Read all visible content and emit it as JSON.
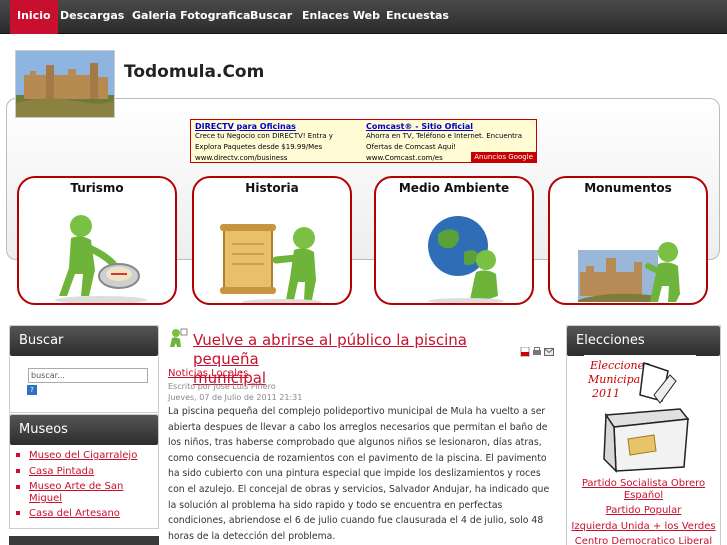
{
  "nav": {
    "items": [
      {
        "label": "Inicio",
        "active": true
      },
      {
        "label": "Descargas"
      },
      {
        "label": "Galeria Fotografica"
      },
      {
        "label": "Buscar"
      },
      {
        "label": "Enlaces Web"
      },
      {
        "label": "Encuestas"
      }
    ]
  },
  "site": {
    "title": "Todomula.Com"
  },
  "ad": {
    "left": {
      "head": "DIRECTV para Oficinas",
      "line1": "Crece tu Negocio con DIRECTV! Entra y",
      "line2": "Explora Paquetes desde $19.99/Mes",
      "line3": "www.directv.com/business"
    },
    "right": {
      "head": "Comcast® - Sitio Oficial",
      "line1": "Ahorra en TV, Teléfono e Internet. Encuentra",
      "line2": "Ofertas de Comcast Aquí!",
      "line3": "www.Comcast.com/es"
    },
    "label": "Anuncios Google"
  },
  "tiles": [
    "Turismo",
    "Historia",
    "Medio Ambiente",
    "Monumentos"
  ],
  "search": {
    "heading": "Buscar",
    "placeholder": "buscar...",
    "go": "?"
  },
  "museos": {
    "heading": "Museos",
    "items": [
      "Museo del Cigarralejo",
      "Casa Pintada",
      "Museo Arte de San",
      "Miguel",
      "Casa del Artesano"
    ]
  },
  "article": {
    "title_line1": "Vuelve a abrirse al público la piscina pequeña",
    "title_line2": "municipal",
    "category": "Noticias Locales",
    "author": "Escrito por Jose Luis Piñero",
    "date": "Jueves, 07 de Julio de 2011 21:31",
    "body": [
      "La piscina pequeña del complejo polideportivo municipal de Mula ha vuelto a ser",
      "abierta despues de llevar a cabo los arreglos necesarios que permitan el baño de",
      "los niños, tras haberse comprobado que algunos niños se lesionaron, días atras,",
      "como consecuencia de rozamientos con el pavimento de la piscina. El pavimento",
      "ha sido cubierto con una pintura especial que impide los deslizamientos y roces",
      "con el azulejo. El concejal de obras y servicios, Salvador Andujar, ha indicado que",
      "la solución al problema ha sido rapido y todo se encuentra en perfectas",
      "condiciones, abriendose el 6 de julio cuando fue clausurada el 4 de julio, solo 48",
      "horas de la detección del problema."
    ]
  },
  "elecciones": {
    "heading": "Elecciones",
    "image_text1": "Elecciones",
    "image_text2": "Municipales",
    "image_text3": "2011",
    "parties": [
      "Partido Socialista Obrero",
      "Español",
      "Partido Popular",
      "Izquierda Unida + los Verdes",
      "Centro Democratico Liberal"
    ]
  },
  "colors": {
    "accent": "#c8102e",
    "nav_bg": "#333333"
  }
}
